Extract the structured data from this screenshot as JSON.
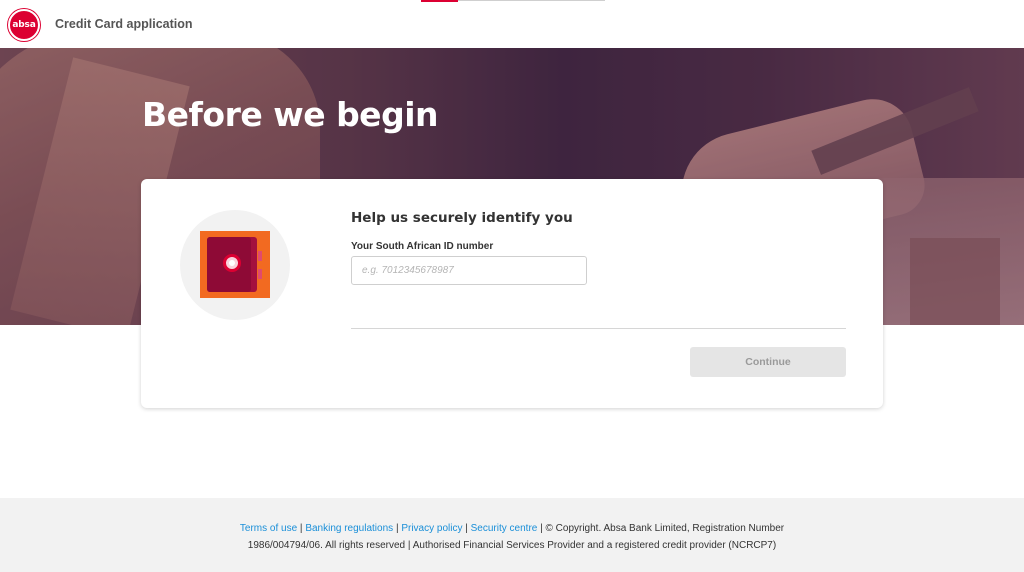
{
  "header": {
    "logo_text": "absa",
    "app_title": "Credit Card application",
    "progress_fraction": 0.2
  },
  "hero": {
    "title": "Before we begin"
  },
  "card": {
    "heading": "Help us securely identify you",
    "id_field": {
      "label": "Your South African ID number",
      "placeholder": "e.g. 7012345678987",
      "value": ""
    },
    "continue_label": "Continue",
    "illustration_icon": "safe-icon"
  },
  "footer": {
    "links": {
      "terms": "Terms of use",
      "banking": "Banking regulations",
      "privacy": "Privacy policy",
      "security": "Security centre"
    },
    "separator": "|",
    "copyright_line1": "© Copyright. Absa Bank Limited, Registration Number",
    "copyright_line2": "1986/004794/06. All rights reserved | Authorised Financial Services Provider and a registered credit provider (NCRCP7)"
  },
  "colors": {
    "brand_red": "#dc0032",
    "safe_orange": "#f26a21",
    "link_blue": "#1a8fd8",
    "button_disabled_bg": "#e5e5e5"
  }
}
